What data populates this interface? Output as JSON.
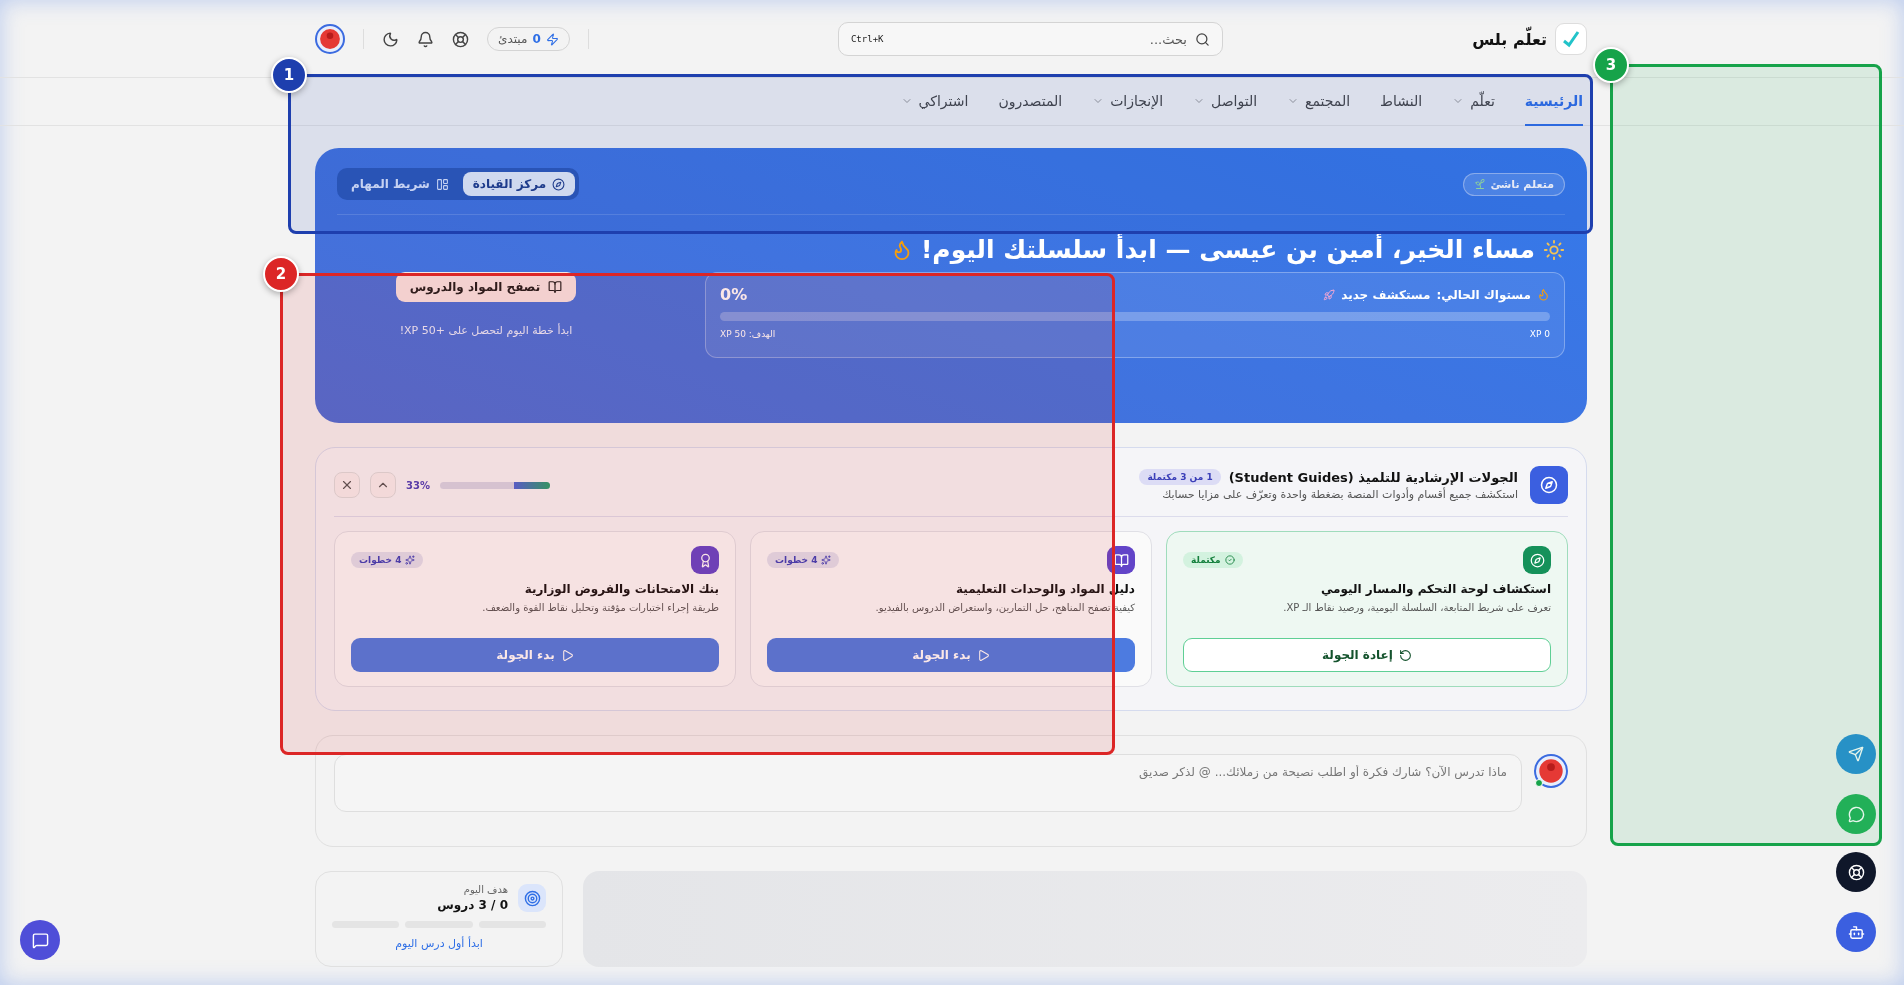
{
  "header": {
    "logo": "تعلّم بلس",
    "search": {
      "placeholder": "بحث...",
      "shortcut": "Ctrl+K"
    },
    "xp": {
      "value": "0",
      "rank": "مبتدئ"
    }
  },
  "nav": [
    {
      "label": "الرئيسية",
      "selected": true,
      "dropdown": false
    },
    {
      "label": "تعلّم",
      "selected": false,
      "dropdown": true
    },
    {
      "label": "النشاط",
      "selected": false,
      "dropdown": false
    },
    {
      "label": "المجتمع",
      "selected": false,
      "dropdown": true
    },
    {
      "label": "التواصل",
      "selected": false,
      "dropdown": true
    },
    {
      "label": "الإنجازات",
      "selected": false,
      "dropdown": true
    },
    {
      "label": "المتصدرون",
      "selected": false,
      "dropdown": false
    },
    {
      "label": "اشتراكي",
      "selected": false,
      "dropdown": true
    }
  ],
  "hero": {
    "rank_badge": "متعلم ناشئ",
    "view_toggle": [
      {
        "label": "مركز القيادة",
        "selected": true
      },
      {
        "label": "شريط المهام",
        "selected": false
      }
    ],
    "greeting": "مساء الخير، أمين بن عيسى — ابدأ سلسلتك اليوم!",
    "level": {
      "label": "مستواك الحالي:",
      "value": "مستكشف جديد",
      "percent": "0%",
      "level": 0,
      "current": "XP 0",
      "goal": "الهدف: XP 50"
    },
    "cta": {
      "button": "تصفح المواد والدروس",
      "hint": "ابدأ خطة اليوم لتحصل على +50 XP!"
    }
  },
  "tours": {
    "title": "الجولات الإرشادية للتلميذ (Student Guides)",
    "badge": "1 من 3 مكتملة",
    "subtitle": "استكشف جميع أقسام وأدوات المنصة بضغطة واحدة وتعرّف على مزايا حسابك",
    "percent": "33%",
    "level": 0.33,
    "cards": [
      {
        "completed": true,
        "badge": "مكتملة",
        "title": "استكشاف لوحة التحكم والمسار اليومي",
        "desc": "تعرف على شريط المتابعة، السلسلة اليومية، ورصيد نقاط الـ XP.",
        "button": "إعادة الجولة"
      },
      {
        "completed": false,
        "badge": "4 خطوات",
        "title": "دليل المواد والوحدات التعليمية",
        "desc": "كيفية تصفح المناهج، حل التمارين، واستعراض الدروس بالفيديو.",
        "button": "بدء الجولة"
      },
      {
        "completed": false,
        "badge": "4 خطوات",
        "title": "بنك الامتحانات والفروض الوزارية",
        "desc": "طريقة إجراء اختبارات مؤقتة وتحليل نقاط القوة والضعف.",
        "button": "بدء الجولة"
      }
    ]
  },
  "composer": {
    "placeholder": "ماذا تدرس الآن؟ شارك فكرة أو اطلب نصيحة من زملائك... @ لذكر صديق"
  },
  "goal": {
    "label": "هدف اليوم",
    "value": "0 / 3 دروس",
    "link": "ابدأ أول درس اليوم"
  },
  "markers": [
    {
      "label": "1",
      "color": "#1e3fae"
    },
    {
      "label": "2",
      "color": "#dc2626"
    },
    {
      "label": "3",
      "color": "#16a34a"
    }
  ]
}
